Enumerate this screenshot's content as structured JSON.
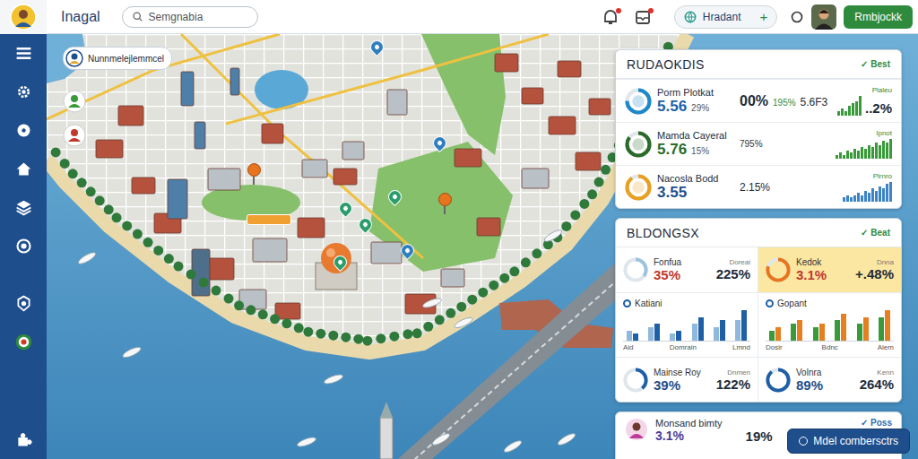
{
  "app": {
    "logo": "Inagal"
  },
  "search": {
    "placeholder": "Semgnabia"
  },
  "topbar": {
    "alerts": [
      {
        "unread": true
      },
      {
        "unread": true
      }
    ],
    "pill": {
      "label": "Hradant",
      "action": "+"
    },
    "button": "Rmbjockk"
  },
  "map": {
    "labels": [
      {
        "text": "Nunnmelejlemmcel"
      }
    ],
    "markers": [
      {
        "color": "#3a9a3a"
      },
      {
        "color": "#c0392b"
      }
    ],
    "pins": [
      {
        "kind": "pin",
        "color": "#2f7fbf"
      },
      {
        "kind": "ball",
        "color": "#e8741e"
      },
      {
        "kind": "pin",
        "color": "#2a9d6a"
      },
      {
        "kind": "pin",
        "color": "#2a9d6a"
      },
      {
        "kind": "pin",
        "color": "#2a9d6a"
      },
      {
        "kind": "ball",
        "color": "#e8741e"
      },
      {
        "kind": "pin",
        "color": "#2a9d6a"
      },
      {
        "kind": "pin",
        "color": "#2f7fbf"
      },
      {
        "kind": "pin",
        "color": "#2f7fbf"
      }
    ]
  },
  "rankings": {
    "title": "RUDAOKDIS",
    "badge": {
      "icon": "✓",
      "label": "Best"
    },
    "rows": [
      {
        "name": "Porm Plotkat",
        "value": "5.56",
        "sub": "29%",
        "color": "#1f5fa6",
        "ring": {
          "level": 0.75,
          "color": "#1e88c8"
        },
        "metrics": [
          {
            "text": "00%",
            "kind": "big"
          },
          {
            "text": "195%",
            "kind": "change"
          },
          {
            "text": "5.6F3",
            "kind": "mid"
          }
        ],
        "bars": [
          2,
          3,
          2,
          4,
          5,
          6,
          8
        ],
        "barColor": "#3a9a3a",
        "tail": "..2%",
        "tag": "Plaleu"
      },
      {
        "name": "Mamda Cayeral",
        "value": "5.76",
        "sub": "15%",
        "color": "#2a6b2a",
        "ring": {
          "level": 0.85,
          "color": "#2a6b2a"
        },
        "metrics": [
          {
            "text": "795%",
            "kind": "small"
          }
        ],
        "bars": [
          2,
          3,
          2,
          4,
          3,
          5,
          4,
          6,
          5,
          7,
          6,
          8,
          7,
          9,
          8,
          10
        ],
        "barColor": "#3a9a3a",
        "tag": "Ipnot"
      },
      {
        "name": "Nacosla Bodd",
        "value": "3.55",
        "color": "#1f4f8a",
        "ring": {
          "level": 0.9,
          "color": "#e8a020"
        },
        "metrics": [
          {
            "text": "2.15%",
            "kind": "mid"
          }
        ],
        "bars": [
          2,
          3,
          2,
          3,
          4,
          3,
          5,
          4,
          6,
          5,
          7,
          6,
          8,
          9
        ],
        "barColor": "#3d84c6",
        "tag": "Plrnro"
      }
    ]
  },
  "buildings": {
    "title": "BLDONGSX",
    "badge": {
      "icon": "✓",
      "label": "Beat"
    },
    "cells": [
      {
        "kind": "ring",
        "label": "Fonfua",
        "value": "35%",
        "caption": "Doreai",
        "value2": "225%",
        "level": 0.35,
        "color": "#9cc3dd",
        "valueColor": "#c0392b",
        "selected": false
      },
      {
        "kind": "ring",
        "label": "Kedok",
        "value": "3.1%",
        "caption": "Dnna",
        "value2": "+.48%",
        "level": 0.8,
        "color": "#e8741e",
        "valueColor": "#c0392b",
        "selected": true
      },
      {
        "kind": "bars",
        "label": "Katiani",
        "series": [
          {
            "color": "#8fb8dc",
            "values": [
              3,
              4,
              2,
              5,
              4,
              6
            ]
          },
          {
            "color": "#1f5fa6",
            "values": [
              2,
              5,
              3,
              7,
              6,
              9
            ]
          }
        ],
        "ticks": [
          "Aid",
          "Domrain",
          "Lmnd"
        ],
        "selected": false
      },
      {
        "kind": "bars",
        "label": "Gopant",
        "series": [
          {
            "color": "#3a9a3a",
            "values": [
              3,
              5,
              4,
              6,
              5,
              7
            ]
          },
          {
            "color": "#e67e22",
            "values": [
              4,
              6,
              5,
              8,
              7,
              9
            ]
          }
        ],
        "ticks": [
          "Dosir",
          "Bdnc",
          "Alem"
        ],
        "selected": false
      },
      {
        "kind": "ring",
        "label": "Mainse Roy",
        "value": "39%",
        "caption": "Dnmen",
        "value2": "122%",
        "level": 0.39,
        "color": "#1f5fa6",
        "valueColor": "#1f4f8a",
        "selected": false
      },
      {
        "kind": "ring",
        "label": "Volnra",
        "value": "89%",
        "caption": "Kenn",
        "value2": "264%",
        "level": 0.89,
        "color": "#1f5fa6",
        "valueColor": "#1f4f8a",
        "selected": false
      }
    ]
  },
  "summary": {
    "name": "Monsand bimty",
    "values": [
      "3.1%",
      "19%"
    ],
    "badge": {
      "icon": "✓",
      "label": "Poss"
    }
  },
  "action": {
    "label": "Mdel combersctrs"
  }
}
